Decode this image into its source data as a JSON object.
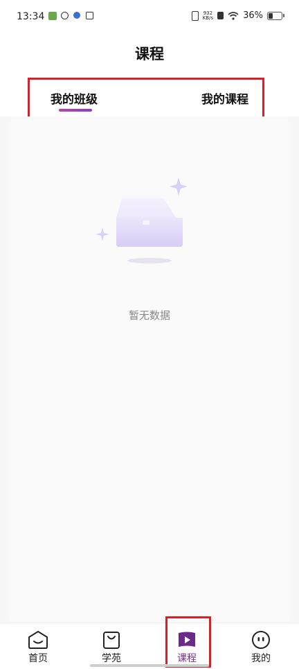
{
  "status_bar": {
    "time": "13:34",
    "net_speed_value": "932",
    "net_speed_unit": "KB/s",
    "battery": "36%"
  },
  "header": {
    "title": "课程"
  },
  "tabs": [
    {
      "label": "我的班级",
      "active": true
    },
    {
      "label": "我的课程",
      "active": false
    }
  ],
  "empty_state": {
    "text": "暂无数据"
  },
  "bottom_nav": {
    "items": [
      {
        "label": "首页",
        "icon": "home-smile-icon"
      },
      {
        "label": "学苑",
        "icon": "shopping-bag-icon"
      },
      {
        "label": "课程",
        "icon": "play-book-icon",
        "active": true
      },
      {
        "label": "我的",
        "icon": "face-icon"
      }
    ]
  },
  "colors": {
    "accent": "#7b2a8f",
    "tab_underline": "#c53bb0",
    "highlight_box": "#d8202a",
    "empty_text": "#888888"
  }
}
